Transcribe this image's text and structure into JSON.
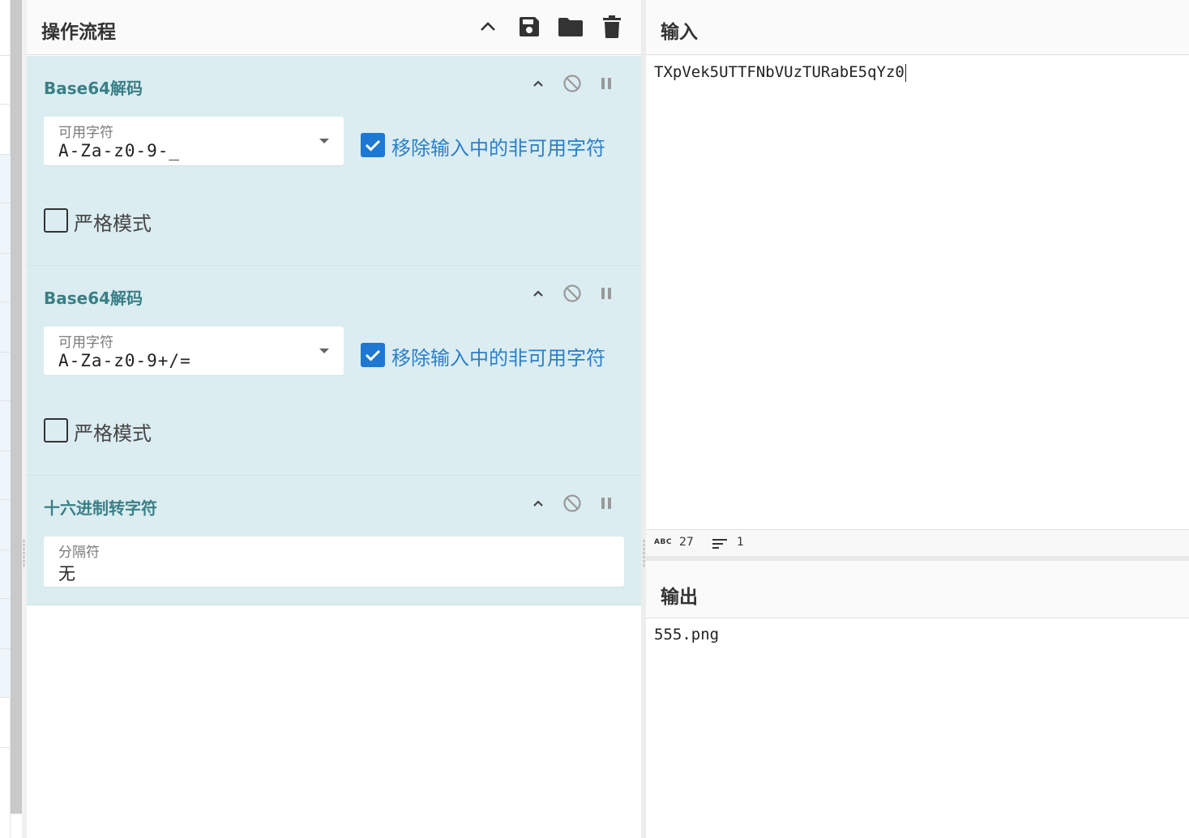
{
  "recipe": {
    "title": "操作流程",
    "operations": [
      {
        "title": "Base64解码",
        "field_label": "可用字符",
        "field_value": "A-Za-z0-9-_",
        "checkbox_remove_label": "移除输入中的非可用字符",
        "checkbox_remove_checked": true,
        "checkbox_strict_label": "严格模式",
        "checkbox_strict_checked": false
      },
      {
        "title": "Base64解码",
        "field_label": "可用字符",
        "field_value": "A-Za-z0-9+/=",
        "checkbox_remove_label": "移除输入中的非可用字符",
        "checkbox_remove_checked": true,
        "checkbox_strict_label": "严格模式",
        "checkbox_strict_checked": false
      },
      {
        "title": "十六进制转字符",
        "field_label": "分隔符",
        "field_value": "无"
      }
    ]
  },
  "input": {
    "title": "输入",
    "text": "TXpVek5UTTFNbVUzTURabE5qYz0"
  },
  "status": {
    "abc_label": "ABC",
    "char_count": "27",
    "line_count": "1"
  },
  "output": {
    "title": "输出",
    "text": "555.png"
  },
  "colors": {
    "operation_bg": "#dbedf1",
    "operation_title": "#3a7f86",
    "checkbox_on": "#1e78d2",
    "checkbox_on_label": "#2a7fc9"
  },
  "icons": [
    "chevron-up-icon",
    "save-icon",
    "folder-icon",
    "trash-icon",
    "disable-icon",
    "pause-icon",
    "dropdown-caret-icon",
    "check-icon",
    "abc-icon",
    "lines-icon"
  ]
}
